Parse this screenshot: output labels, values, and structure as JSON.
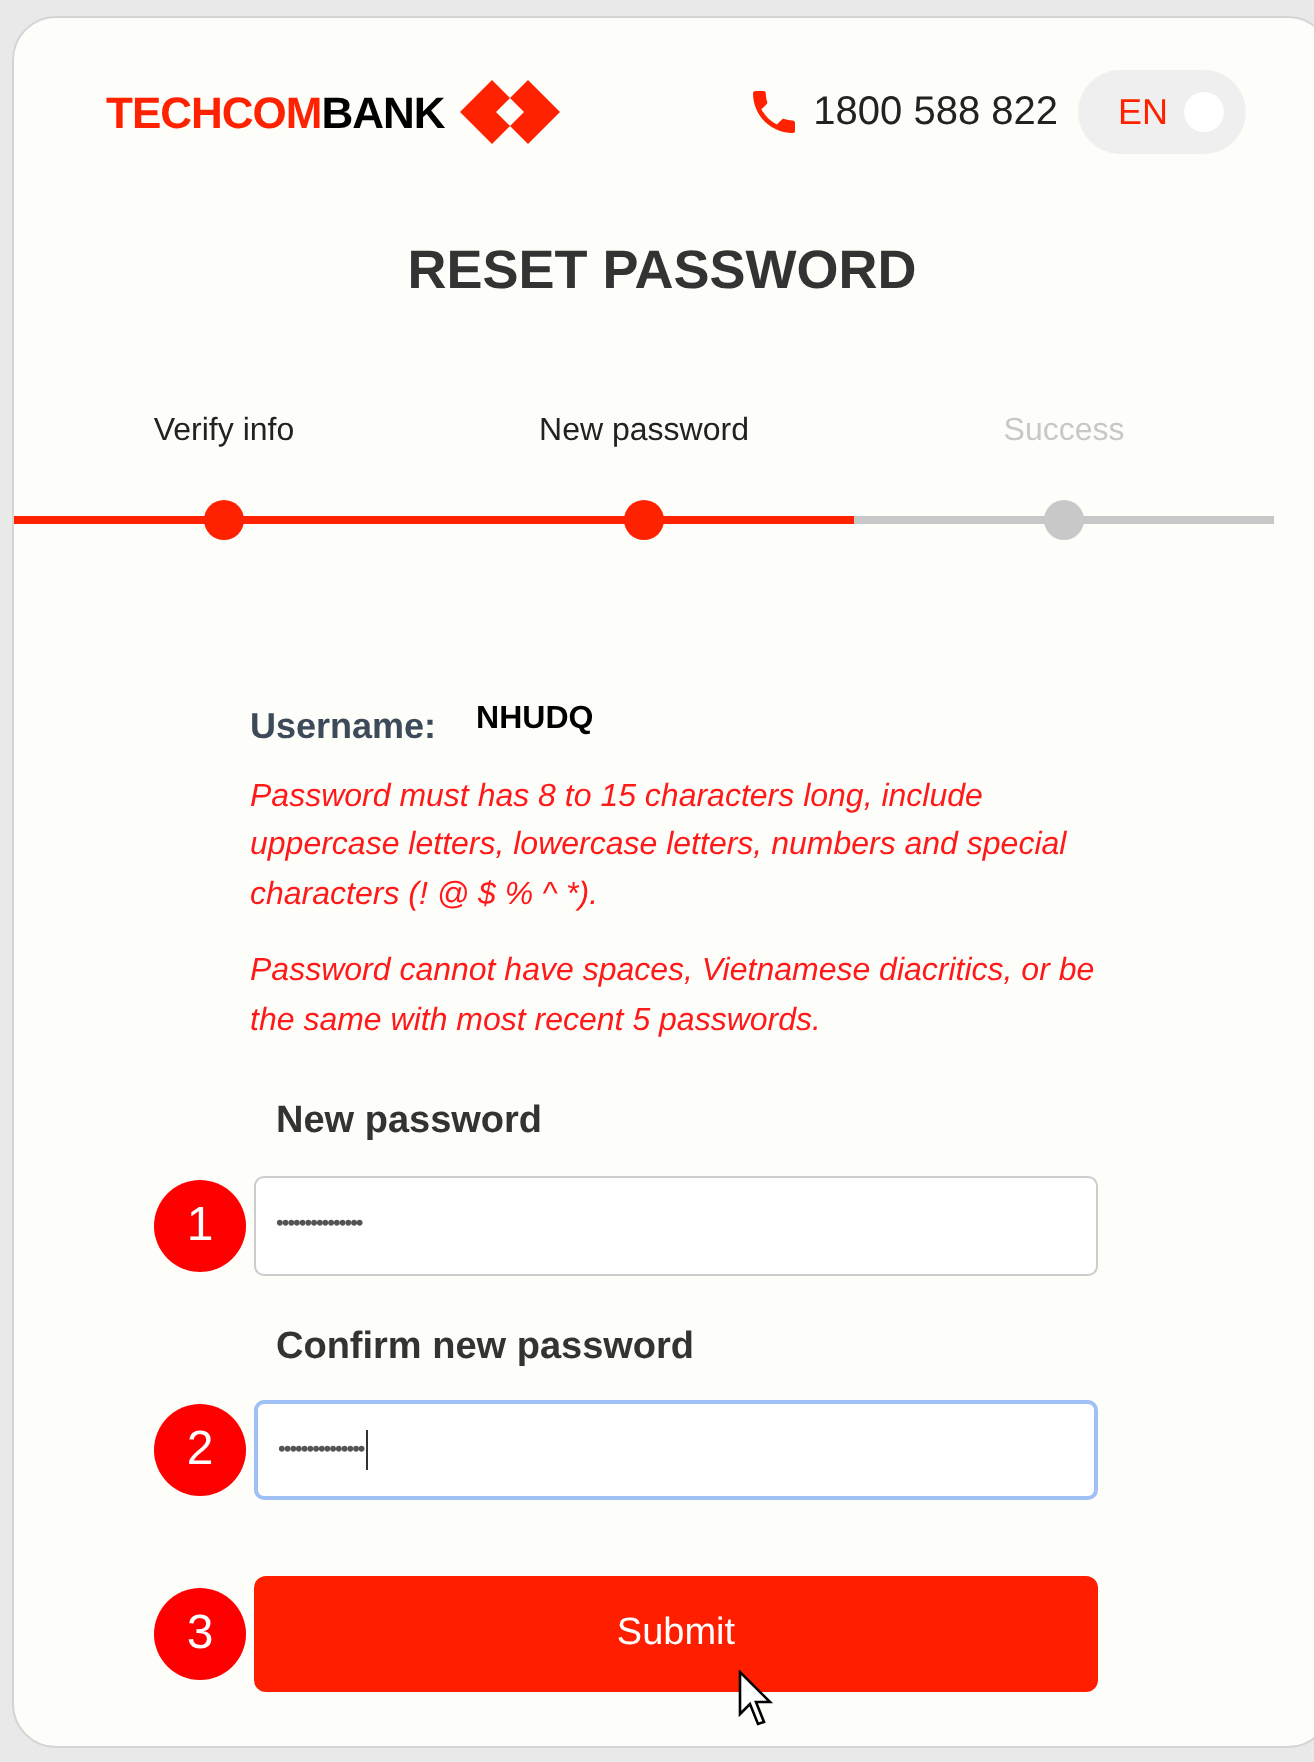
{
  "header": {
    "logo": {
      "part_1": "TECHCOM",
      "part_2": "BANK"
    },
    "hotline": "1800 588 822",
    "language": "EN"
  },
  "title": "RESET PASSWORD",
  "steps": [
    {
      "label": "Verify info",
      "reached": true
    },
    {
      "label": "New password",
      "reached": true
    },
    {
      "label": "Success",
      "reached": false
    }
  ],
  "username": {
    "label": "Username:",
    "value": "NHUDQ"
  },
  "rules": [
    "Password must has 8 to 15 characters long, include uppercase letters, lowercase letters, numbers and special characters (! @ $ % ^ *).",
    "Password cannot have spaces, Vietnamese diacritics, or be the same with most recent 5 passwords."
  ],
  "fields": [
    {
      "marker": "1",
      "label": "New password",
      "value": "•••••••••••••••",
      "focused": false
    },
    {
      "marker": "2",
      "label": "Confirm new password",
      "value": "•••••••••••••••",
      "focused": true
    }
  ],
  "submit": {
    "marker": "3",
    "label": "Submit"
  }
}
